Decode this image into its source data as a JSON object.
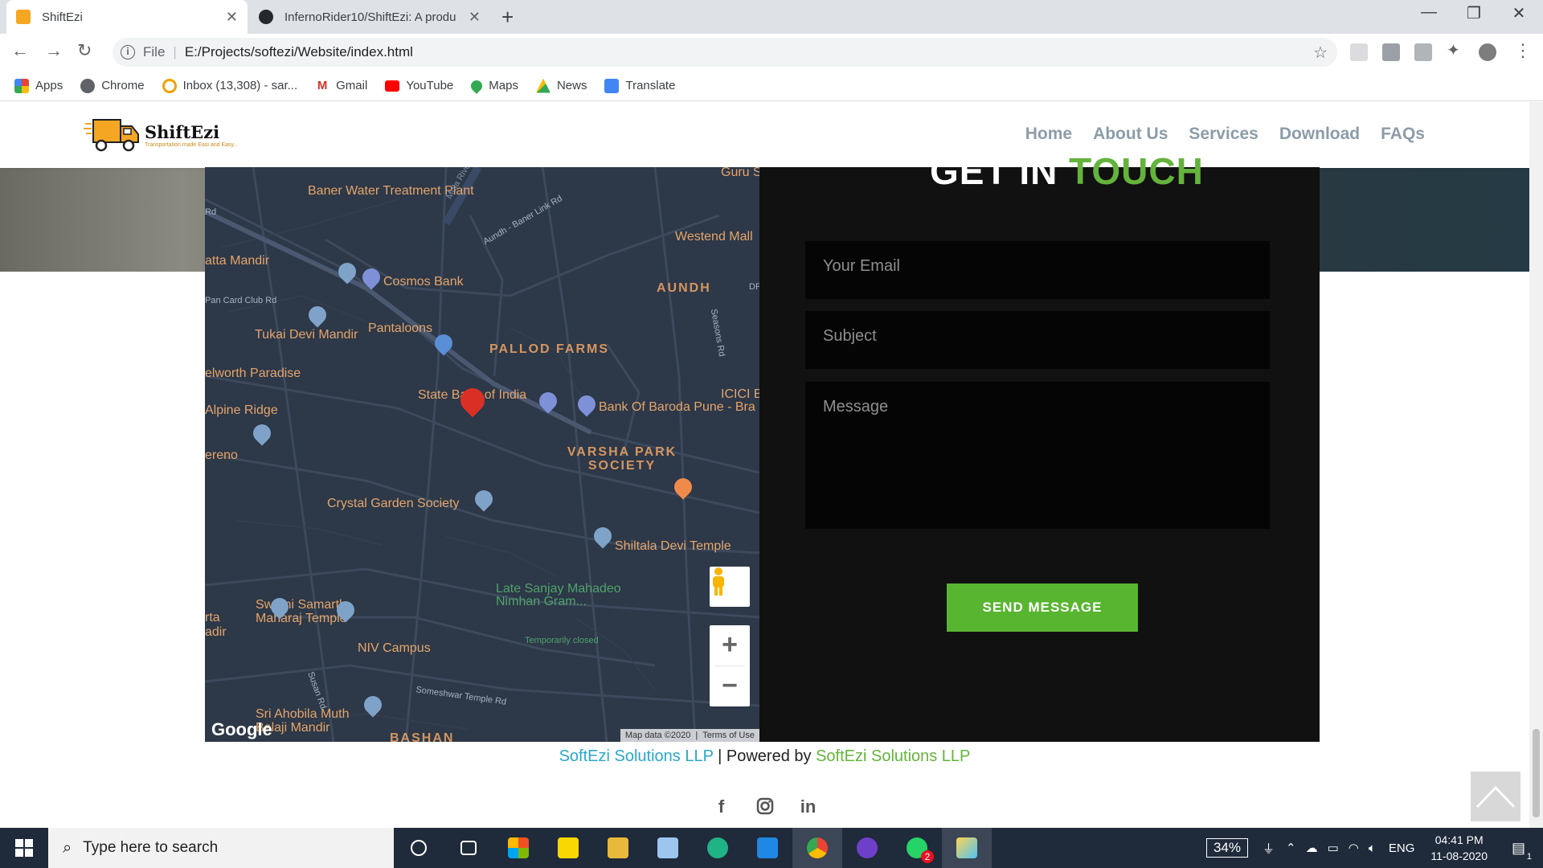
{
  "browser": {
    "tabs": [
      {
        "title": "ShiftEzi",
        "favicon": "truck-favicon",
        "active": true
      },
      {
        "title": "InfernoRider10/ShiftEzi: A produ",
        "favicon": "github-favicon",
        "active": false
      }
    ],
    "new_tab_icon": "+",
    "window_controls": [
      "—",
      "❐",
      "✕"
    ],
    "address": {
      "scheme": "File",
      "url": "E:/Projects/softezi/Website/index.html"
    },
    "bookmarks": [
      {
        "label": "Apps",
        "icon": "apps-grid-icon",
        "color": "#ea4335"
      },
      {
        "label": "Chrome",
        "icon": "chrome-icon",
        "color": "#5f6368"
      },
      {
        "label": "Inbox (13,308) - sar...",
        "icon": "quora-icon",
        "color": "#f4a000"
      },
      {
        "label": "Gmail",
        "icon": "gmail-icon",
        "color": "#d93025"
      },
      {
        "label": "YouTube",
        "icon": "youtube-icon",
        "color": "#ff0000"
      },
      {
        "label": "Maps",
        "icon": "maps-icon",
        "color": "#34a853"
      },
      {
        "label": "News",
        "icon": "news-icon",
        "color": "#fbbc04"
      },
      {
        "label": "Translate",
        "icon": "translate-icon",
        "color": "#4285f4"
      }
    ]
  },
  "site": {
    "logo": {
      "name": "ShiftEzi",
      "tagline": "Transportation made Easi and Easy..."
    },
    "nav": [
      "Home",
      "About Us",
      "Services",
      "Download",
      "FAQs"
    ],
    "colors": {
      "accent_green": "#58b530",
      "link_blue": "#2aa7c9"
    }
  },
  "map": {
    "labels": [
      "Baner Water Treatment Plant",
      "Cosmos Bank",
      "Pantaloons",
      "Tukai Devi Mandir",
      "PALLOD FARMS",
      "State Bank of India",
      "Bank Of Baroda Pune - Bra",
      "ICICI B",
      "VARSHA PARK SOCIETY",
      "Crystal Garden Society",
      "Shiltala Devi Temple",
      "Late Sanjay Mahadeo Nimhan Gram...",
      "Temporarily closed",
      "Swami Samarth Maharaj Temple",
      "NIV Campus",
      "Sri Ahobila Muth Balaji Mandir",
      "Westend Mall",
      "AUNDH",
      "Guru S",
      "atta Mandir",
      "elworth Paradise",
      "Alpine Ridge",
      "ereno",
      "rta",
      "adir",
      "Pan Card Club Rd",
      "Aundh - Baner Link Rd",
      "Mula River",
      "Someshwar Temple Rd",
      "Seasons Rd",
      "Susan Rd",
      "Rd",
      "BASHAN",
      "DP"
    ],
    "google": "Google",
    "attribution": [
      "Map data ©2020",
      "Terms of Use"
    ]
  },
  "contact": {
    "title_white": "GET IN",
    "title_green": "TOUCH",
    "email_placeholder": "Your Email",
    "subject_placeholder": "Subject",
    "message_placeholder": "Message",
    "send_label": "SEND MESSAGE"
  },
  "footer": {
    "company": "SoftEzi Solutions LLP",
    "separator": "| Powered by",
    "powered_by": "SoftEzi Solutions LLP",
    "socials": [
      "facebook-icon",
      "instagram-icon",
      "linkedin-icon"
    ]
  },
  "taskbar": {
    "search_placeholder": "Type here to search",
    "battery": "34%",
    "language": "ENG",
    "time": "04:41 PM",
    "date": "11-08-2020",
    "notification_count": "1",
    "whatsapp_badge": "2"
  }
}
